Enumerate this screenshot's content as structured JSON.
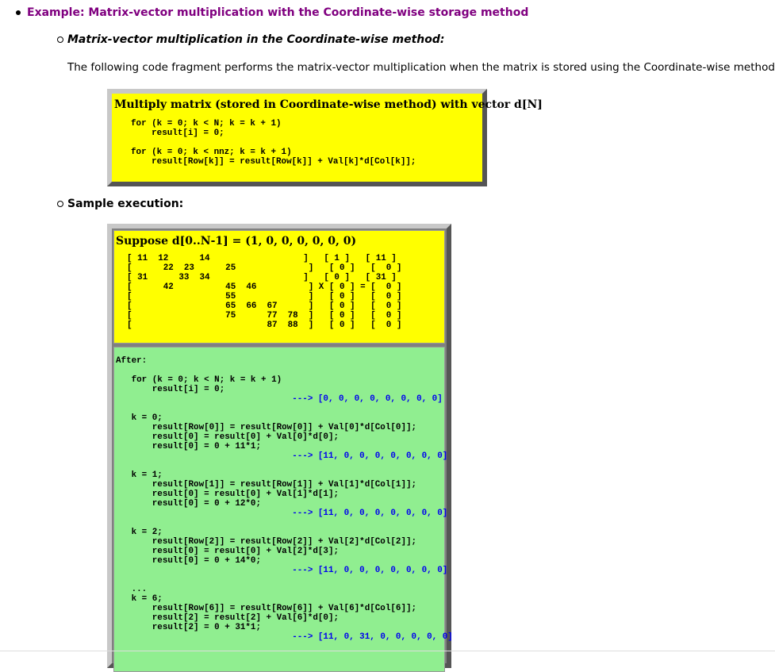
{
  "example_title": "Example: Matrix-vector multiplication with the Coordinate-wise storage method",
  "section1": {
    "heading": "Matrix-vector multiplication in the Coordinate-wise method:",
    "intro": "The following code fragment performs the matrix-vector multiplication when the matrix is stored using the Coordinate-wise method:",
    "box_title": "Multiply matrix (stored in Coordinate-wise method) with vector d[N]",
    "code": [
      "for (k = 0; k < N; k = k + 1)",
      "    result[i] = 0;",
      "",
      "for (k = 0; k < nnz; k = k + 1)",
      "    result[Row[k]] = result[Row[k]] + Val[k]*d[Col[k]];"
    ]
  },
  "section2": {
    "heading": "Sample execution:",
    "box_title": "Suppose d[0..N-1] = (1, 0, 0, 0, 0, 0, 0)",
    "matrix_lines": [
      "[ 11  12      14                  ]   [ 1 ]   [ 11 ]",
      "[      22  23      25              ]   [ 0 ]   [  0 ]",
      "[ 31      33  34                  ]   [ 0 ]   [ 31 ]",
      "[      42          45  46          ] X [ 0 ] = [  0 ]",
      "[                  55              ]   [ 0 ]   [  0 ]",
      "[                  65  66  67      ]   [ 0 ]   [  0 ]",
      "[                  75      77  78  ]   [ 0 ]   [  0 ]",
      "[                          87  88  ]   [ 0 ]   [  0 ]"
    ],
    "after_label": "After:",
    "after_lines": [
      {
        "t": "",
        "a": ""
      },
      {
        "t": "   for (k = 0; k < N; k = k + 1)",
        "a": ""
      },
      {
        "t": "       result[i] = 0;",
        "a": ""
      },
      {
        "t": "                                  ",
        "a": "---> [0, 0, 0, 0, 0, 0, 0, 0]"
      },
      {
        "t": "",
        "a": ""
      },
      {
        "t": "   k = 0;",
        "a": ""
      },
      {
        "t": "       result[Row[0]] = result[Row[0]] + Val[0]*d[Col[0]];",
        "a": ""
      },
      {
        "t": "       result[0] = result[0] + Val[0]*d[0];",
        "a": ""
      },
      {
        "t": "       result[0] = 0 + 11*1;",
        "a": ""
      },
      {
        "t": "                                  ",
        "a": "---> [11, 0, 0, 0, 0, 0, 0, 0]"
      },
      {
        "t": "",
        "a": ""
      },
      {
        "t": "   k = 1;",
        "a": ""
      },
      {
        "t": "       result[Row[1]] = result[Row[1]] + Val[1]*d[Col[1]];",
        "a": ""
      },
      {
        "t": "       result[0] = result[0] + Val[1]*d[1];",
        "a": ""
      },
      {
        "t": "       result[0] = 0 + 12*0;",
        "a": ""
      },
      {
        "t": "                                  ",
        "a": "---> [11, 0, 0, 0, 0, 0, 0, 0]"
      },
      {
        "t": "",
        "a": ""
      },
      {
        "t": "   k = 2;",
        "a": ""
      },
      {
        "t": "       result[Row[2]] = result[Row[2]] + Val[2]*d[Col[2]];",
        "a": ""
      },
      {
        "t": "       result[0] = result[0] + Val[2]*d[3];",
        "a": ""
      },
      {
        "t": "       result[0] = 0 + 14*0;",
        "a": ""
      },
      {
        "t": "                                  ",
        "a": "---> [11, 0, 0, 0, 0, 0, 0, 0]"
      },
      {
        "t": "",
        "a": ""
      },
      {
        "t": "   ...",
        "a": ""
      },
      {
        "t": "   k = 6;",
        "a": ""
      },
      {
        "t": "       result[Row[6]] = result[Row[6]] + Val[6]*d[Col[6]];",
        "a": ""
      },
      {
        "t": "       result[2] = result[2] + Val[6]*d[0];",
        "a": ""
      },
      {
        "t": "       result[2] = 0 + 31*1;",
        "a": ""
      },
      {
        "t": "                                  ",
        "a": "---> [11, 0, 31, 0, 0, 0, 0, 0]"
      }
    ]
  },
  "colors": {
    "title": "#800080",
    "box_yellow": "#ffff00",
    "box_green": "#90ee90",
    "arrow": "#0000ee"
  }
}
